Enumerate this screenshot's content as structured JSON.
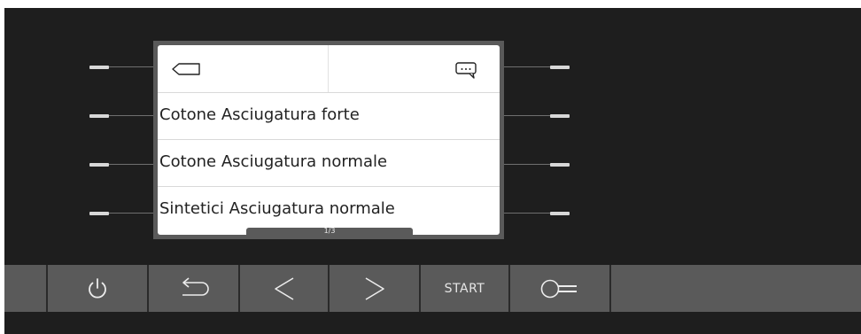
{
  "screen": {
    "rows": [
      {
        "label": "Cotone Asciugatura forte"
      },
      {
        "label": "Cotone Asciugatura normale"
      },
      {
        "label": "Sintetici Asciugatura normale"
      }
    ],
    "page_indicator": "1/3",
    "back_icon": "back-tag-icon",
    "info_icon": "speech-bubble-icon"
  },
  "keys": {
    "power_icon": "power-icon",
    "back_icon": "return-arrow-icon",
    "prev_icon": "chevron-left-icon",
    "next_icon": "chevron-right-icon",
    "start_label": "START",
    "lock_icon": "key-lock-icon"
  },
  "colors": {
    "panel": "#1e1e1e",
    "keys": "#5a5a5a",
    "screen_bg": "#ffffff",
    "side_buttons": "#d8d8d8"
  }
}
